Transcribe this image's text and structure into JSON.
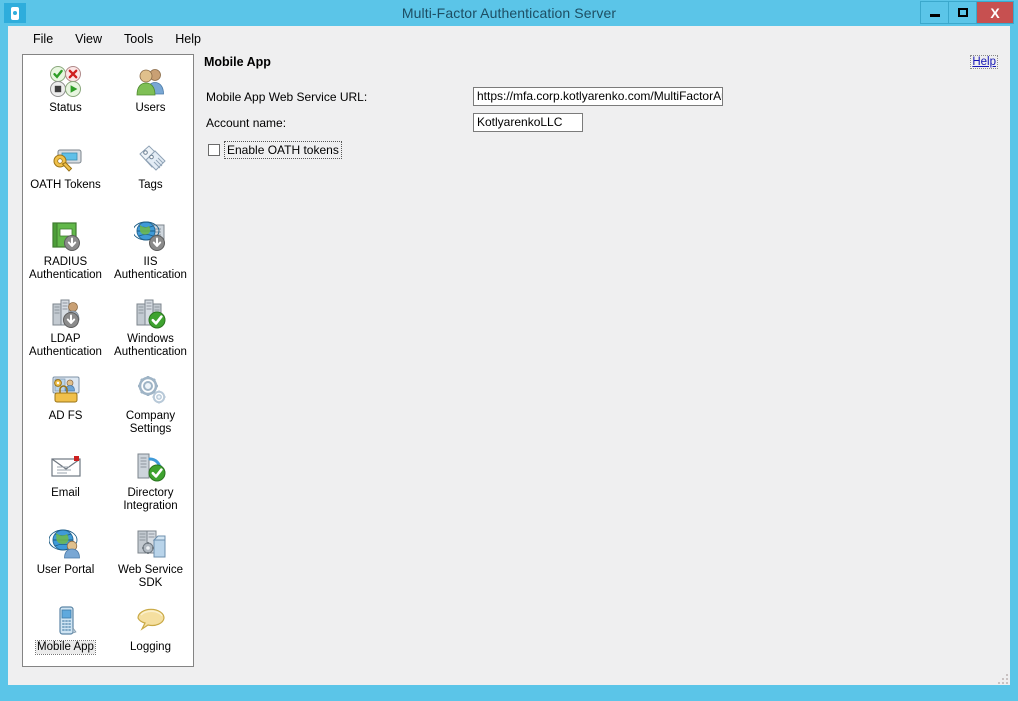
{
  "window": {
    "title": "Multi-Factor Authentication Server",
    "app_icon": "key-fob-icon",
    "controls": {
      "minimize": "–",
      "maximize": "□",
      "close": "X"
    },
    "frame_color": "#5bc5e8",
    "close_color": "#c75050"
  },
  "menubar": {
    "items": [
      {
        "label": "File"
      },
      {
        "label": "View"
      },
      {
        "label": "Tools"
      },
      {
        "label": "Help"
      }
    ]
  },
  "sidebar": {
    "items": [
      {
        "label": "Status",
        "icon": "status-icon",
        "selected": false
      },
      {
        "label": "Users",
        "icon": "users-icon",
        "selected": false
      },
      {
        "label": "OATH Tokens",
        "icon": "oath-tokens-icon",
        "selected": false
      },
      {
        "label": "Tags",
        "icon": "tags-icon",
        "selected": false
      },
      {
        "label": "RADIUS Authentication",
        "icon": "radius-authentication-icon",
        "selected": false
      },
      {
        "label": "IIS Authentication",
        "icon": "iis-authentication-icon",
        "selected": false
      },
      {
        "label": "LDAP Authentication",
        "icon": "ldap-authentication-icon",
        "selected": false
      },
      {
        "label": "Windows Authentication",
        "icon": "windows-authentication-icon",
        "selected": false
      },
      {
        "label": "AD FS",
        "icon": "adfs-icon",
        "selected": false
      },
      {
        "label": "Company Settings",
        "icon": "company-settings-icon",
        "selected": false
      },
      {
        "label": "Email",
        "icon": "email-icon",
        "selected": false
      },
      {
        "label": "Directory Integration",
        "icon": "directory-integration-icon",
        "selected": false
      },
      {
        "label": "User Portal",
        "icon": "user-portal-icon",
        "selected": false
      },
      {
        "label": "Web Service SDK",
        "icon": "web-service-sdk-icon",
        "selected": false
      },
      {
        "label": "Mobile App",
        "icon": "mobile-app-icon",
        "selected": true
      },
      {
        "label": "Logging",
        "icon": "logging-icon",
        "selected": false
      }
    ]
  },
  "content": {
    "section_title": "Mobile App",
    "help_link": "Help",
    "fields": {
      "web_service_url": {
        "label": "Mobile App Web Service URL:",
        "value": "https://mfa.corp.kotlyarenko.com/MultiFactorAuthM",
        "placeholder": ""
      },
      "account_name": {
        "label": "Account name:",
        "value": "KotlyarenkoLLC",
        "placeholder": ""
      }
    },
    "checkbox": {
      "label": "Enable OATH tokens",
      "checked": false
    }
  }
}
